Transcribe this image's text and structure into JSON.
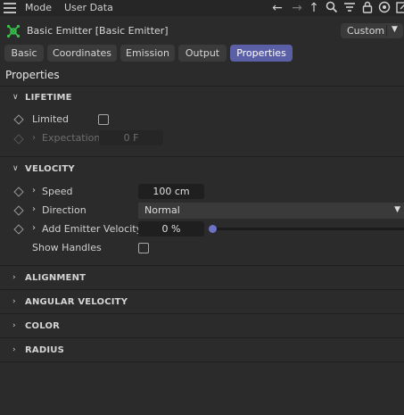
{
  "topbar": {
    "menu": [
      "Mode",
      "User Data"
    ],
    "icons": [
      "back-arrow-icon",
      "forward-arrow-icon",
      "up-arrow-icon",
      "search-icon",
      "filter-icon",
      "lock-icon",
      "target-icon",
      "new-window-icon"
    ]
  },
  "object": {
    "title": "Basic Emitter [Basic Emitter]",
    "icon": "emitter-icon",
    "layout_dropdown": "Custom"
  },
  "tabs": [
    "Basic",
    "Coordinates",
    "Emission",
    "Output",
    "Properties"
  ],
  "active_tab": "Properties",
  "section_title": "Properties",
  "groups": {
    "lifetime": {
      "label": "LIFETIME",
      "limited_label": "Limited",
      "limited_checked": false,
      "expectation_label": "Expectation",
      "expectation_value": "0 F"
    },
    "velocity": {
      "label": "VELOCITY",
      "speed_label": "Speed",
      "speed_value": "100 cm",
      "direction_label": "Direction",
      "direction_value": "Normal",
      "add_velocity_label": "Add Emitter Velocity",
      "add_velocity_value": "0 %",
      "add_velocity_fraction": 0,
      "show_handles_label": "Show Handles",
      "show_handles_checked": false
    },
    "alignment": {
      "label": "ALIGNMENT"
    },
    "angular_velocity": {
      "label": "ANGULAR VELOCITY"
    },
    "color": {
      "label": "COLOR"
    },
    "radius": {
      "label": "RADIUS"
    }
  },
  "colors": {
    "background": "#2b2b2b",
    "active_tab": "#5a5fa6",
    "slider_knob": "#6e72c4",
    "emitter_icon": "#37c24a"
  }
}
